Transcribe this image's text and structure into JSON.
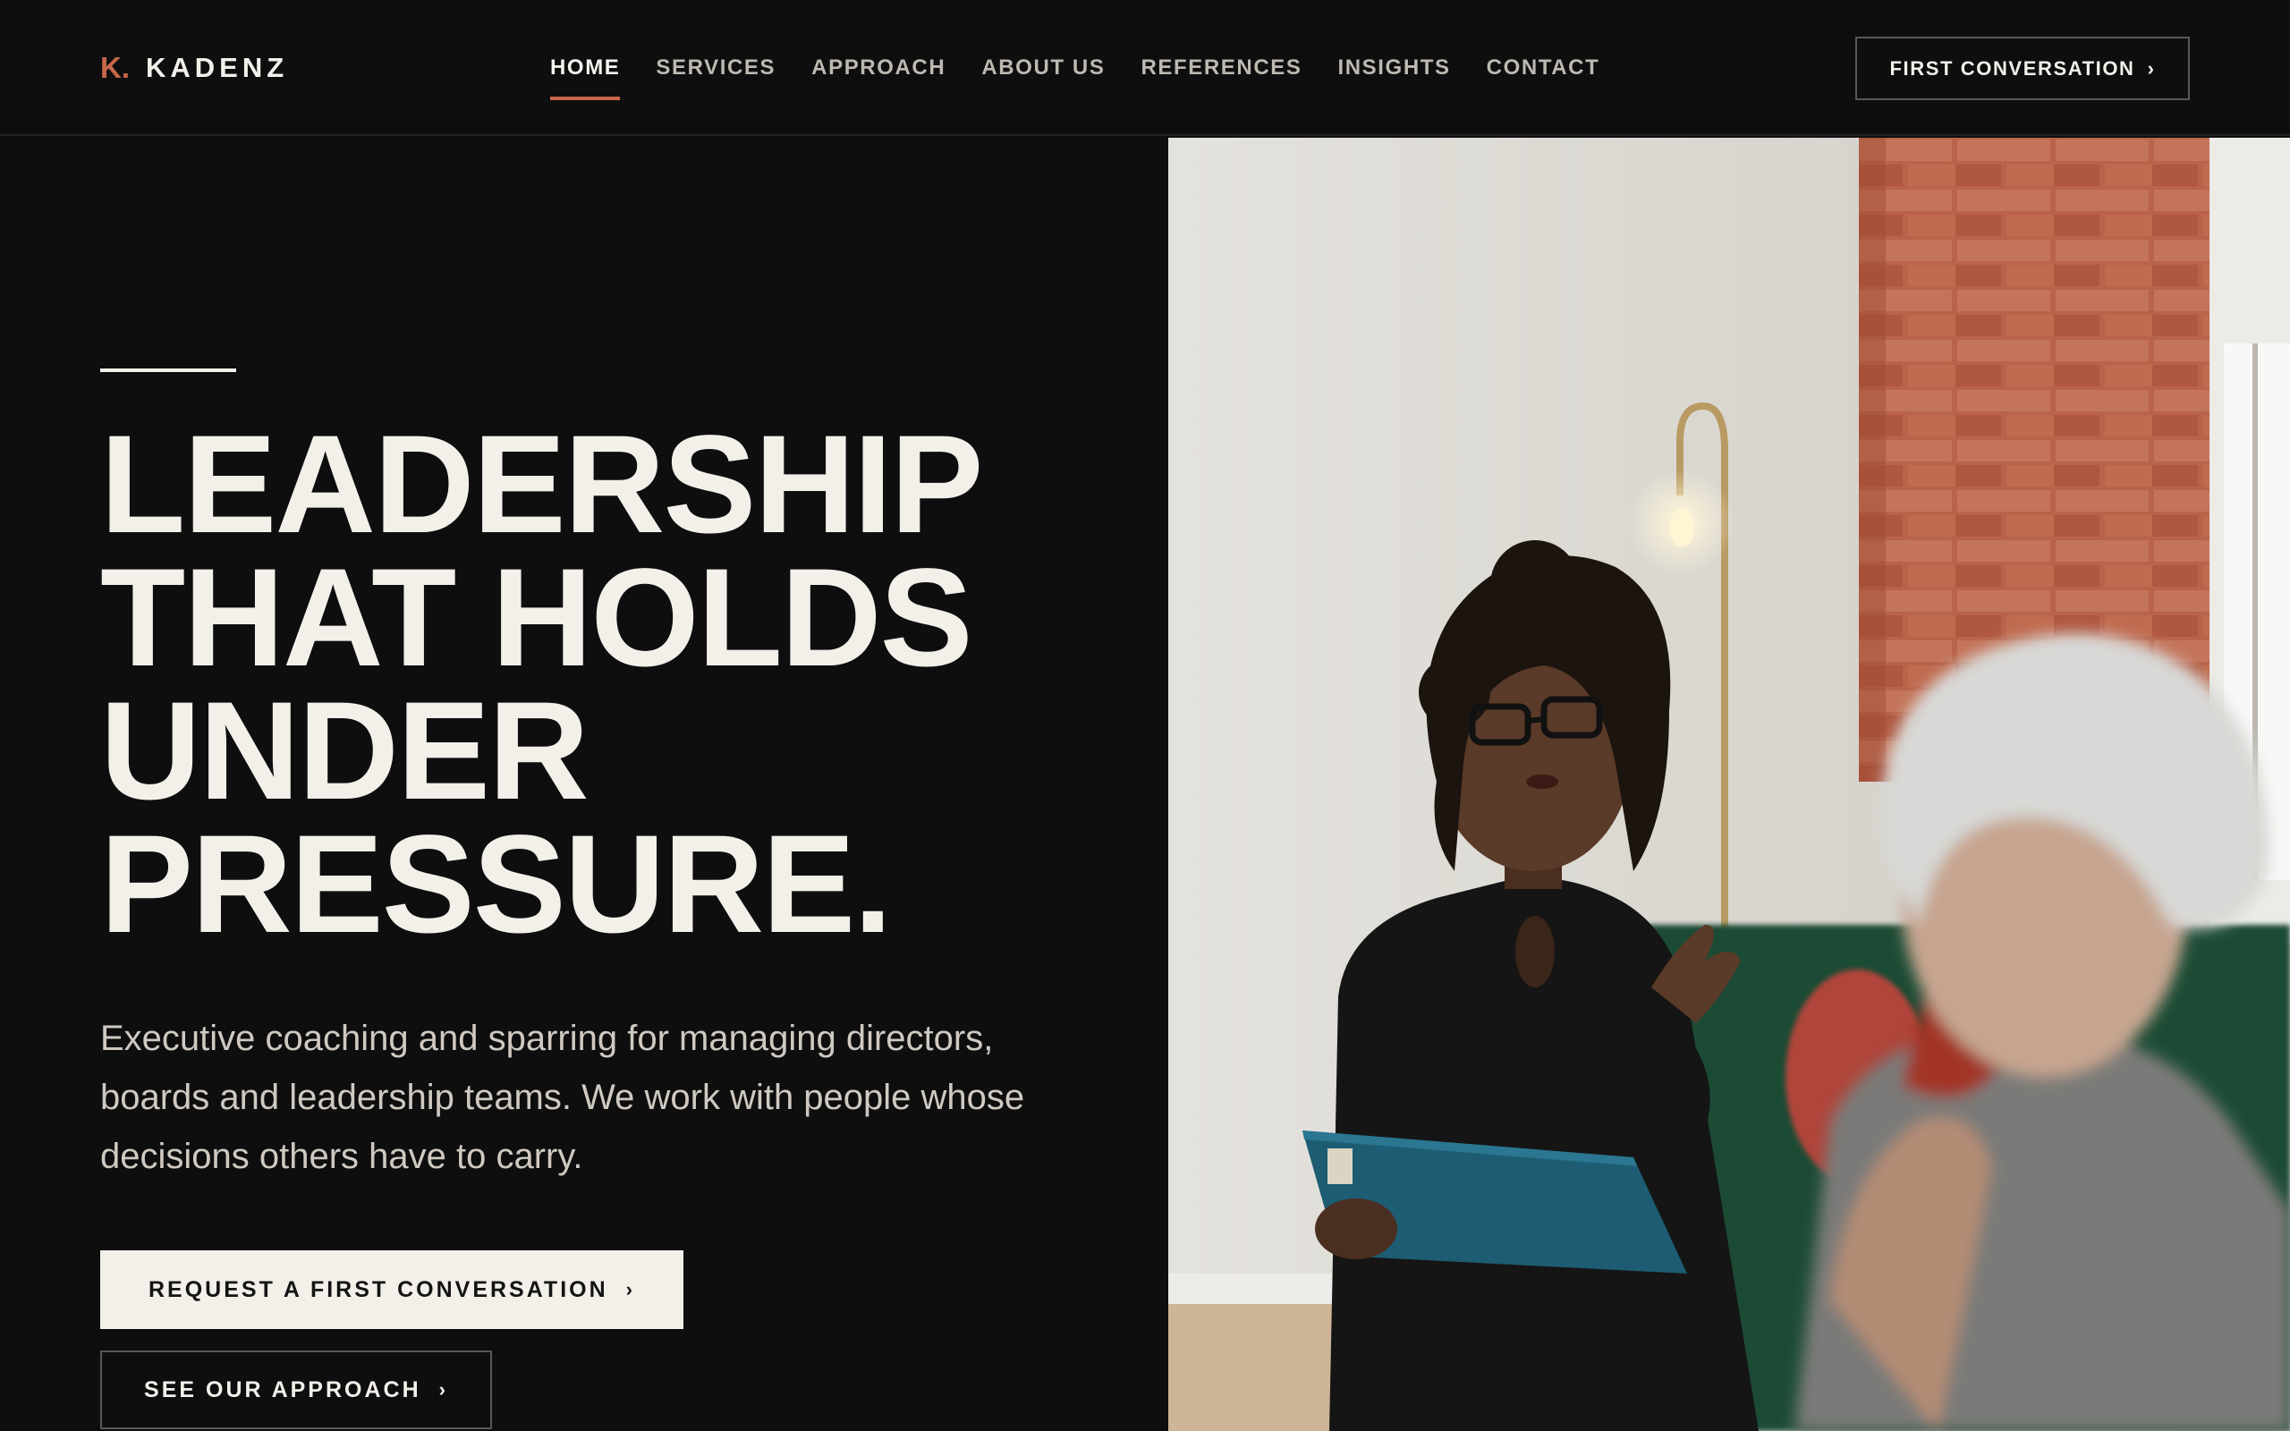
{
  "header": {
    "logo_mark": "K.",
    "logo_name": "KADENZ",
    "nav": [
      {
        "label": "HOME",
        "active": true
      },
      {
        "label": "SERVICES",
        "active": false
      },
      {
        "label": "APPROACH",
        "active": false
      },
      {
        "label": "ABOUT US",
        "active": false
      },
      {
        "label": "REFERENCES",
        "active": false
      },
      {
        "label": "INSIGHTS",
        "active": false
      },
      {
        "label": "CONTACT",
        "active": false
      }
    ],
    "cta_label": "FIRST CONVERSATION",
    "cta_icon": "chevron-right-icon"
  },
  "hero": {
    "headline_lines": [
      "LEADERSHIP",
      "THAT HOLDS",
      "UNDER",
      "PRESSURE."
    ],
    "subtext": "Executive coaching and sparring for managing directors, boards and leadership teams. We work with people whose decisions others have to carry.",
    "primary_cta": "REQUEST A FIRST CONVERSATION",
    "secondary_cta": "SEE OUR APPROACH",
    "chevron": "›"
  },
  "colors": {
    "background": "#0e0e0f",
    "accent": "#c8674a",
    "text": "#f3f0ea",
    "muted_text": "#cfc9c1"
  }
}
